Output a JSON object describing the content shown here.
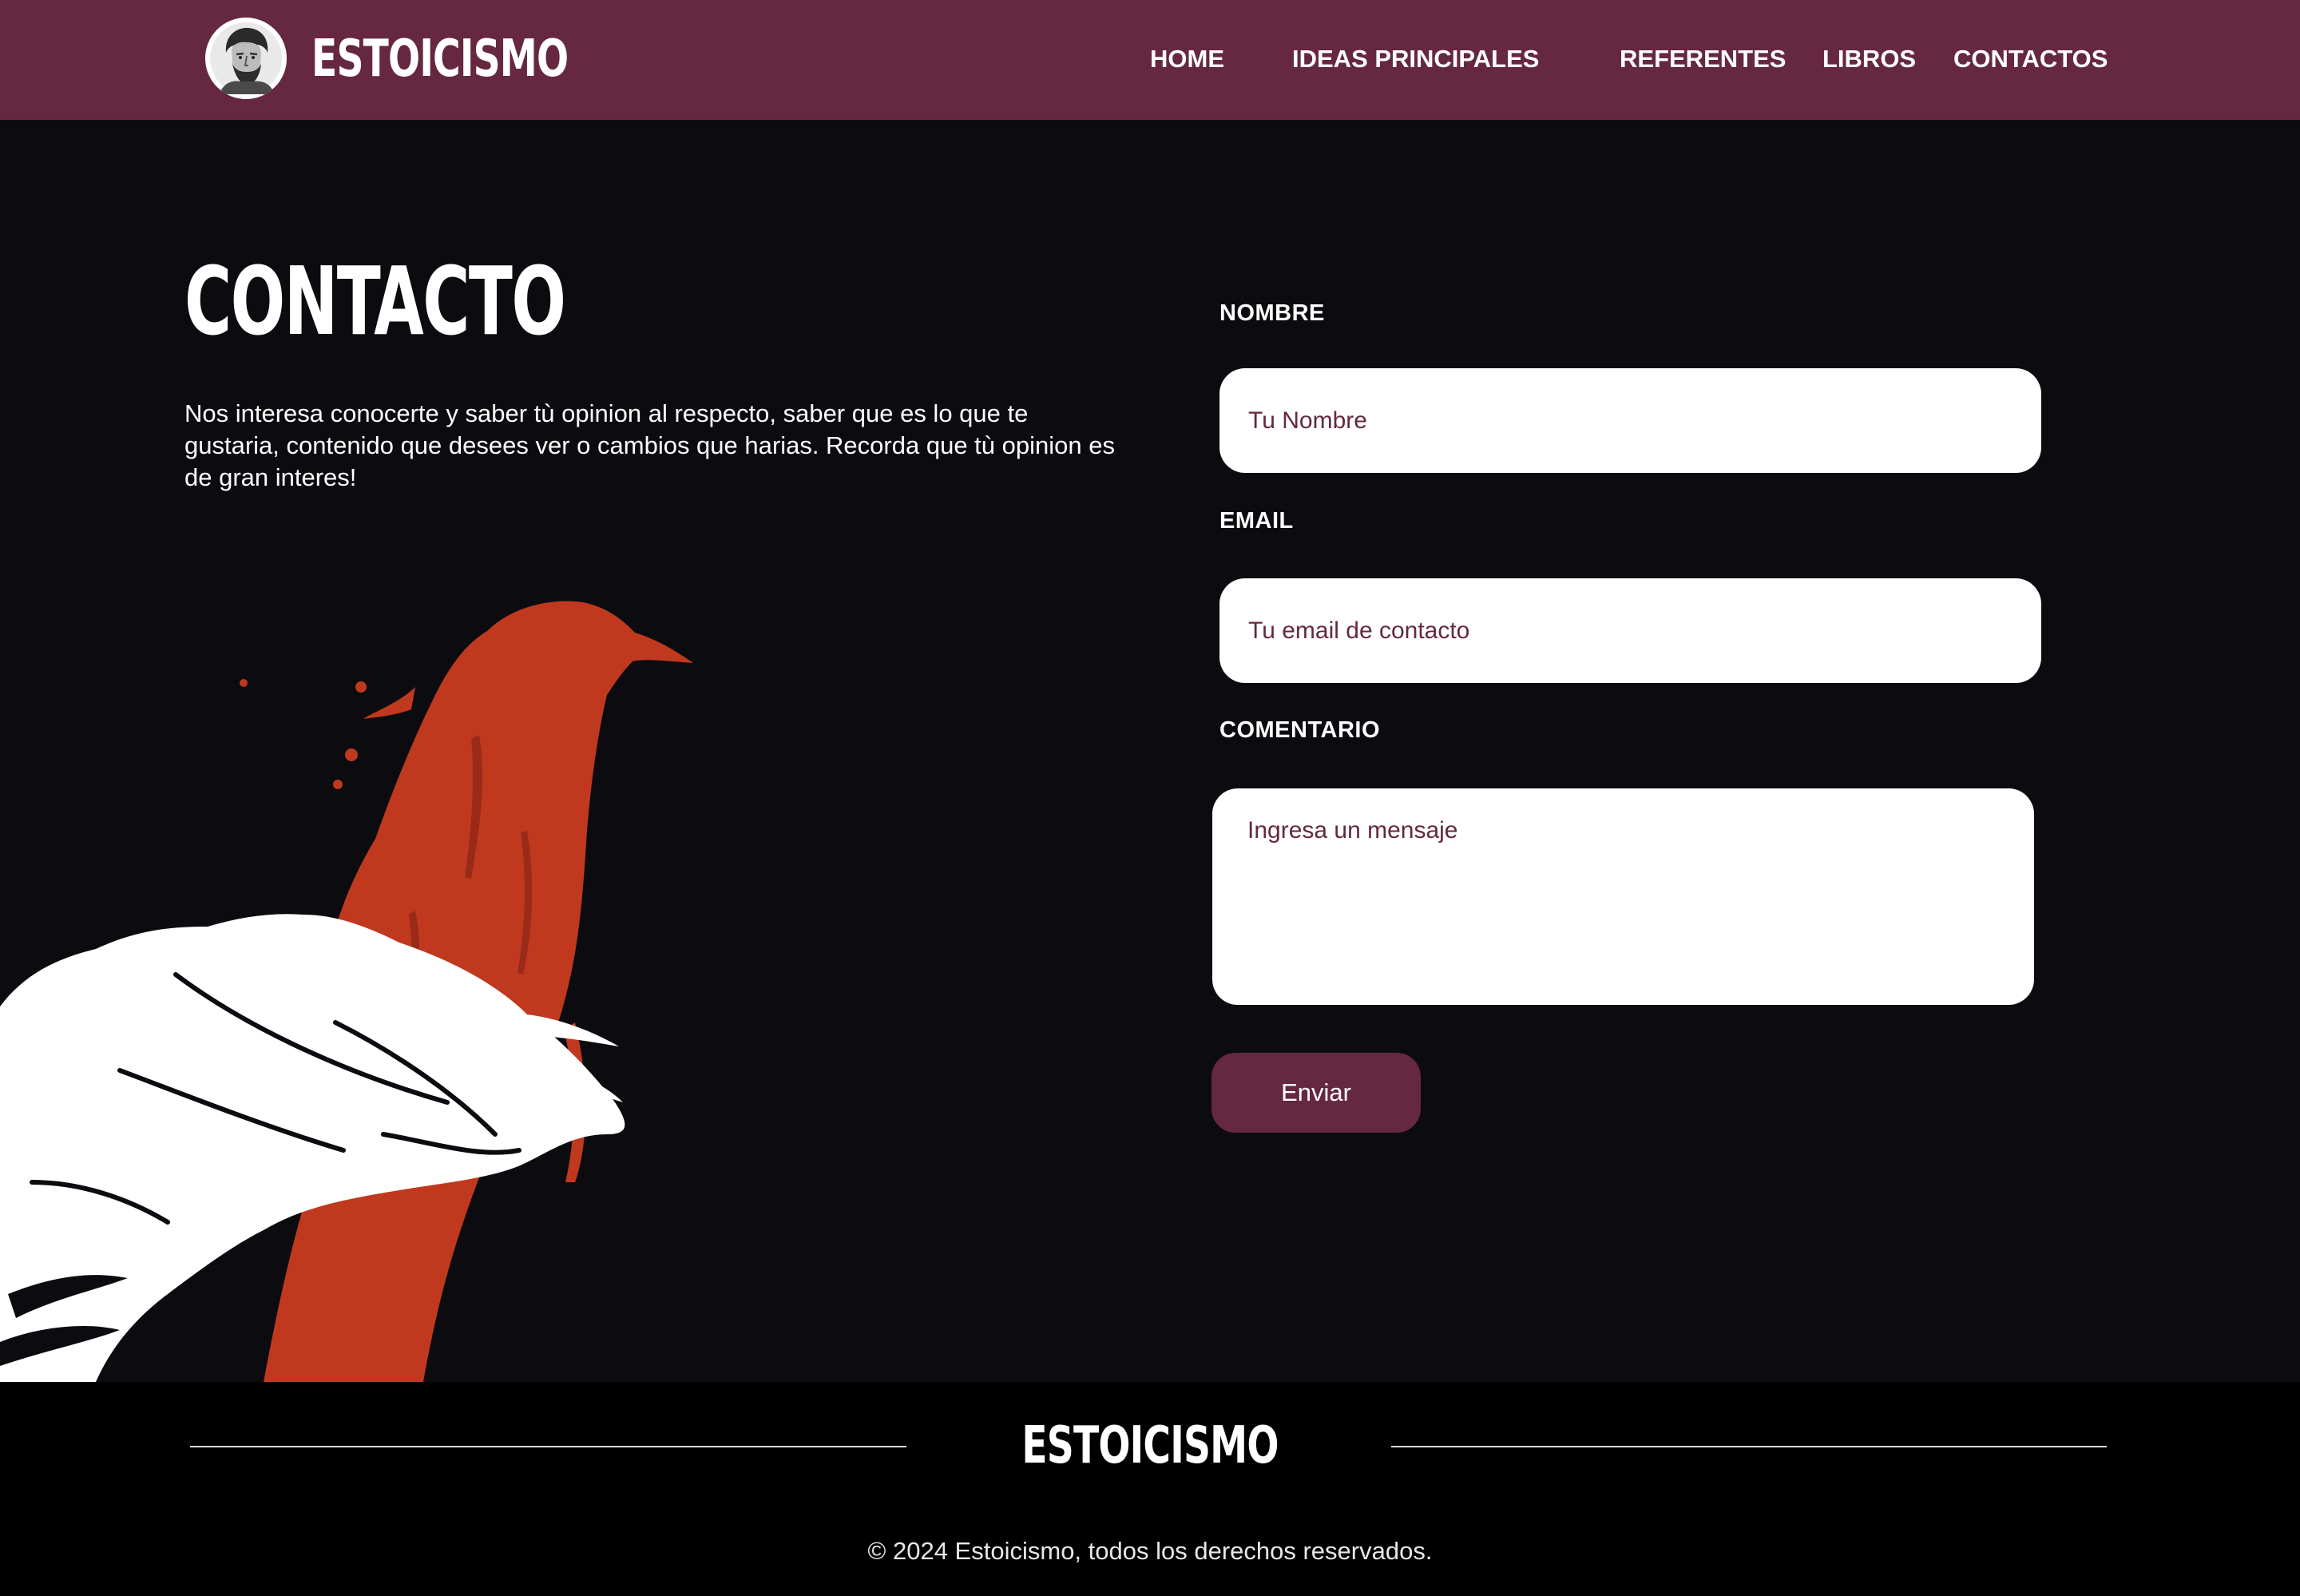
{
  "brand": {
    "name": "ESTOICISMO",
    "logo_icon": "stoic-bust-icon"
  },
  "nav": {
    "items": [
      {
        "label": "HOME"
      },
      {
        "label": "IDEAS PRINCIPALES"
      },
      {
        "label": "REFERENTES"
      },
      {
        "label": "LIBROS"
      },
      {
        "label": "CONTACTOS"
      }
    ]
  },
  "contact": {
    "title": "CONTACTO",
    "intro": "Nos interesa conocerte y saber tù opinion al respecto, saber que es lo que te gustaria, contenido que desees ver o cambios que harias. Recorda que tù opinion es de gran interes!",
    "illustration": "crow-and-feather-illustration"
  },
  "form": {
    "name_label": "NOMBRE",
    "name_placeholder": "Tu Nombre",
    "name_value": "",
    "email_label": "EMAIL",
    "email_placeholder": "Tu email de contacto",
    "email_value": "",
    "comment_label": "COMENTARIO",
    "comment_placeholder": "Ingresa un mensaje",
    "comment_value": "",
    "submit_label": "Enviar"
  },
  "footer": {
    "logo": "ESTOICISMO",
    "copyright": "© 2024 Estoicismo, todos los derechos reservados."
  },
  "colors": {
    "brand": "#652840",
    "page_background": "#0c0c10",
    "footer_background": "#000000",
    "crow": "#c0391f",
    "feather": "#ffffff"
  }
}
